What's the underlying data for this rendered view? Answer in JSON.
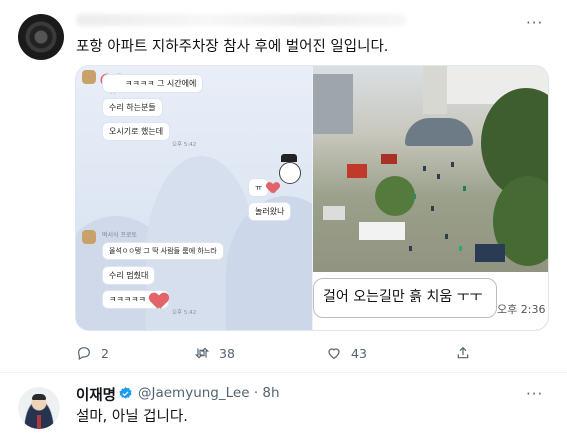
{
  "tweet": {
    "text": "포항 아파트 지하주차장 참사 후에 벌어진 일입니다.",
    "more_label": "···",
    "chat": {
      "msg1": "ㅋㅋㅋㅋ 그 시간에에",
      "msg2": "수리 하는분들",
      "msg3": "오시기로 했는데",
      "time1": "오후 5:42",
      "my_msg1": "ㅠ",
      "my_msg2": "놀러왔나",
      "sender2": "떡서식 프로토",
      "msg4": "올석ㅇㅇ탱 그 딱 사람들 룸에 하느라",
      "msg5": "수리 멈췄대",
      "msg6": "ㅋㅋㅋㅋㅋ",
      "time2": "오후 5:42"
    },
    "photo_caption": "걸어 오는길만 흙 치움 ㅜㅜ",
    "photo_time": "오후 2:36",
    "actions": {
      "replies": "2",
      "retweets": "38",
      "likes": "43"
    }
  },
  "reply": {
    "name": "이재명",
    "handle": "@Jaemyung_Lee · 8h",
    "text": "설마, 아닐 겁니다.",
    "more_label": "···"
  },
  "colors": {
    "verified": "#1d9bf0",
    "muted": "#536471",
    "text": "#0f1419"
  }
}
